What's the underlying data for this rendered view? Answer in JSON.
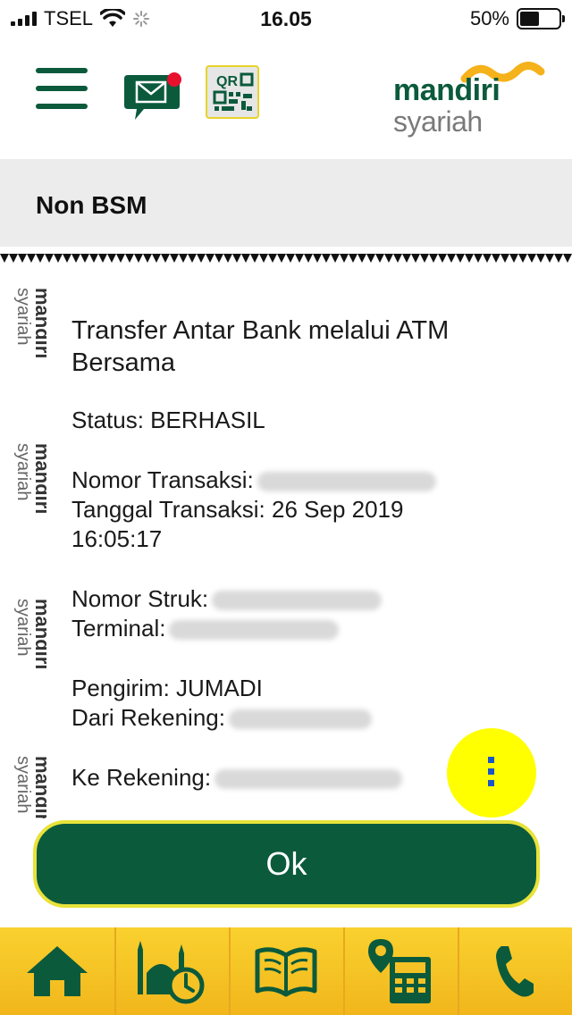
{
  "status_bar": {
    "carrier": "TSEL",
    "time": "16.05",
    "battery": "50%",
    "battery_level": 0.5
  },
  "header": {
    "logo_line1": "mandiri",
    "logo_line2": "syariah",
    "icons": [
      "hamburger-menu-icon",
      "message-icon",
      "qr-code-icon"
    ],
    "qr_label": "QR"
  },
  "page": {
    "title": "Non BSM"
  },
  "receipt": {
    "watermark": "mandiri syariah",
    "title": "Transfer Antar Bank melalui ATM Bersama",
    "status": "Status: BERHASIL",
    "transaction_number_label": "Nomor Transaksi:",
    "transaction_date": "Tanggal Transaksi: 26 Sep 2019 16:05:17",
    "receipt_number_label": "Nomor Struk:",
    "terminal_label": "Terminal:",
    "sender": "Pengirim: JUMADI",
    "from_account_label": "Dari Rekening:",
    "to_account_label": "Ke Rekening:"
  },
  "actions": {
    "ok_label": "Ok",
    "more_icon": "vertical-dots-icon"
  },
  "bottom_nav": {
    "items": [
      "home-icon",
      "mosque-time-icon",
      "quran-icon",
      "atm-location-icon",
      "phone-icon"
    ]
  },
  "colors": {
    "brand_green": "#0b5a3c",
    "brand_yellow": "#f5c226",
    "fab_yellow": "#ffff00",
    "notification_red": "#e8112d"
  }
}
